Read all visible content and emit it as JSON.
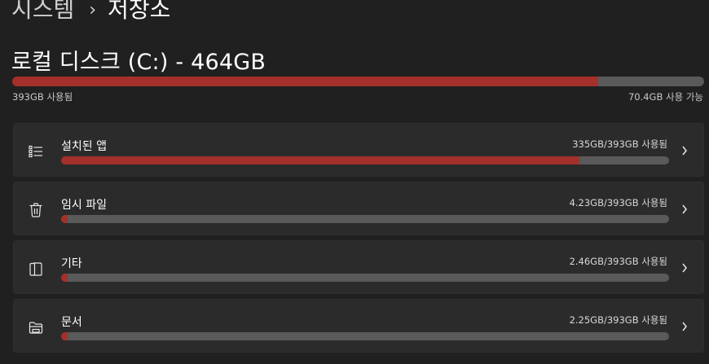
{
  "breadcrumb": {
    "parent": "시스템",
    "separator": "›",
    "current": "저장소"
  },
  "disk": {
    "title": "로컬 디스크 (C:) - 464GB",
    "used_label": "393GB 사용됨",
    "free_label": "70.4GB 사용 가능",
    "used_fraction": 0.847
  },
  "categories": [
    {
      "name": "설치된 앱",
      "usage": "335GB/393GB 사용됨",
      "icon": "list-icon",
      "fraction": 0.852
    },
    {
      "name": "임시 파일",
      "usage": "4.23GB/393GB 사용됨",
      "icon": "trash-icon",
      "fraction": 0.011
    },
    {
      "name": "기타",
      "usage": "2.46GB/393GB 사용됨",
      "icon": "other-files-icon",
      "fraction": 0.006
    },
    {
      "name": "문서",
      "usage": "2.25GB/393GB 사용됨",
      "icon": "folder-icon",
      "fraction": 0.006
    }
  ],
  "colors": {
    "background": "#202020",
    "card": "#2b2b2b",
    "bar_track": "#5a5a5a",
    "bar_fill": "#a3302a"
  }
}
